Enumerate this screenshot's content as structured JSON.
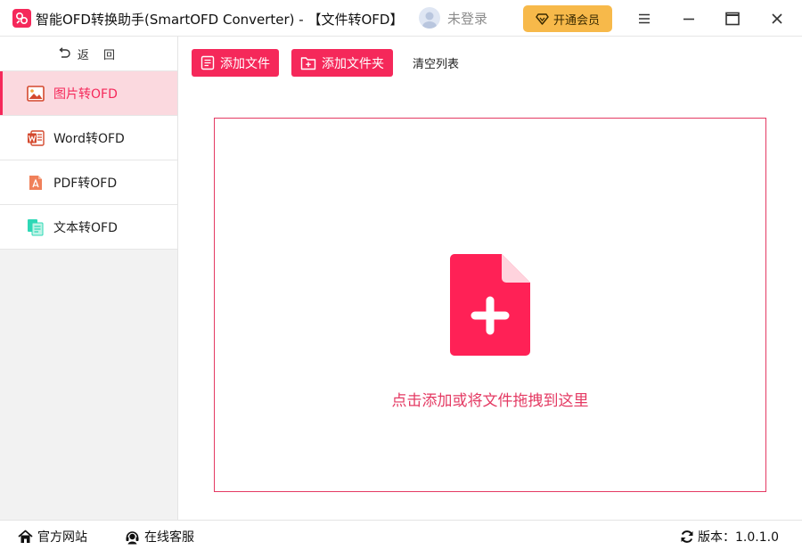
{
  "app": {
    "title": "智能OFD转换助手(SmartOFD Converter) - 【文件转OFD】",
    "brand_color": "#f5285a"
  },
  "header": {
    "login_text": "未登录",
    "vip_label": "开通会员",
    "vip_color": "#f7b94a",
    "window_controls": [
      "menu-icon",
      "minimize-icon",
      "maximize-icon",
      "close-icon"
    ]
  },
  "sidebar": {
    "back_label": "返 回",
    "items": [
      {
        "label": "图片转OFD",
        "icon": "image-icon",
        "active": true
      },
      {
        "label": "Word转OFD",
        "icon": "word-icon",
        "active": false
      },
      {
        "label": "PDF转OFD",
        "icon": "pdf-icon",
        "active": false
      },
      {
        "label": "文本转OFD",
        "icon": "text-file-icon",
        "active": false
      }
    ]
  },
  "toolbar": {
    "add_file_label": "添加文件",
    "add_folder_label": "添加文件夹",
    "clear_label": "清空列表"
  },
  "dropzone": {
    "hint": "点击添加或将文件拖拽到这里",
    "icon": "file-add-icon"
  },
  "statusbar": {
    "website_label": "官方网站",
    "support_label": "在线客服",
    "version_label": "版本：1.0.1.0"
  }
}
